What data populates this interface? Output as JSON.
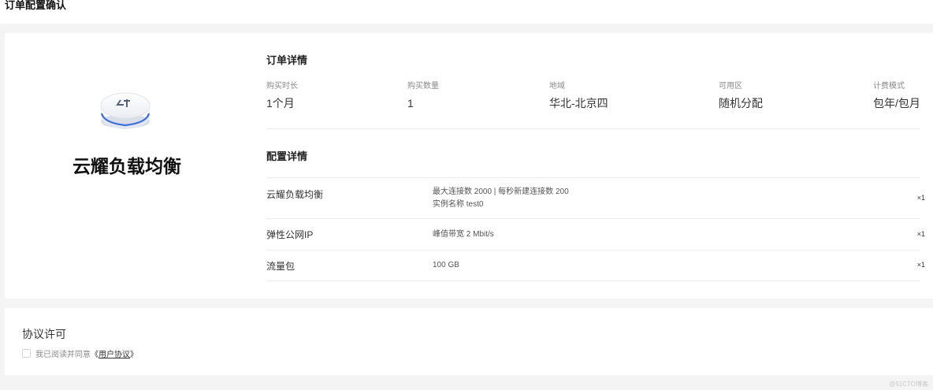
{
  "page": {
    "title": "订单配置确认"
  },
  "product": {
    "name": "云耀负载均衡",
    "icon": "load-balancer-device-icon"
  },
  "order": {
    "title": "订单详情",
    "fields": [
      {
        "label": "购买时长",
        "value": "1个月"
      },
      {
        "label": "购买数量",
        "value": "1"
      },
      {
        "label": "地域",
        "value": "华北-北京四"
      },
      {
        "label": "可用区",
        "value": "随机分配"
      },
      {
        "label": "计费模式",
        "value": "包年/包月"
      }
    ]
  },
  "config": {
    "title": "配置详情",
    "rows": [
      {
        "name": "云耀负载均衡",
        "desc1": "最大连接数 2000 | 每秒新建连接数 200",
        "desc2": "实例名称 test0",
        "qty": "×1"
      },
      {
        "name": "弹性公网IP",
        "desc1": "峰值带宽 2 Mbit/s",
        "desc2": "",
        "qty": "×1"
      },
      {
        "name": "流量包",
        "desc1": "100 GB",
        "desc2": "",
        "qty": "×1"
      }
    ]
  },
  "agreement": {
    "title": "协议许可",
    "text": "我已阅读并同意",
    "open_bracket": "《",
    "link": "用户协议",
    "close_bracket": "》",
    "checked": false
  },
  "watermark": "@51CTO博客",
  "colors": {
    "background": "#f4f4f4",
    "card": "#ffffff",
    "accent_blue": "#3b6fe0"
  }
}
